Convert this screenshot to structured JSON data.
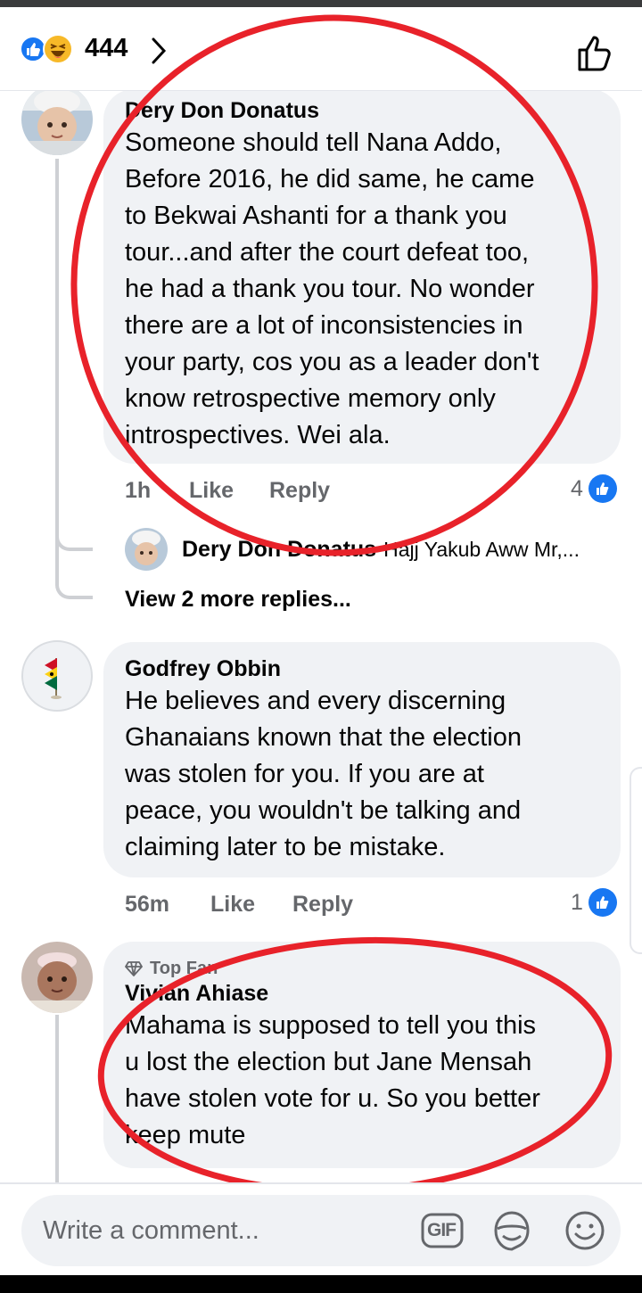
{
  "header": {
    "reaction_count": "444",
    "reaction_icons": [
      "like-icon",
      "haha-icon"
    ],
    "chevron_icon": "chevron-right-icon",
    "like_button_icon": "thumbs-up-outline-icon"
  },
  "comments": [
    {
      "author": "Dery Don Donatus",
      "text": "Someone should tell Nana Addo, Before 2016, he did same, he came to Bekwai Ashanti for a thank you tour...and after the court defeat too, he had a thank you tour. No wonder there are a lot of inconsistencies in your party, cos you as a leader don't know retrospective memory only introspectives. Wei ala.",
      "lines": [
        "Someone should tell Nana Addo,",
        "Before 2016, he did same, he came",
        "to Bekwai Ashanti for a thank you",
        "tour...and after the court defeat too,",
        "he had a thank you tour. No wonder",
        "there are a lot of inconsistencies in",
        "your party, cos you as a leader don't",
        "know retrospective memory only",
        "introspectives. Wei ala."
      ],
      "time": "1h",
      "like_label": "Like",
      "reply_label": "Reply",
      "reactions": "4",
      "reply_preview": {
        "author": "Dery Don Donatus",
        "snippet": "Hajj Yakub Aww Mr,..."
      },
      "more_replies": "View 2 more replies..."
    },
    {
      "author": "Godfrey Obbin",
      "lines": [
        "He believes and every discerning",
        "Ghanaians known that the election",
        "was stolen for you. If you are at",
        "peace, you wouldn't be talking and",
        "claiming later to be mistake."
      ],
      "time": "56m",
      "like_label": "Like",
      "reply_label": "Reply",
      "reactions": "1"
    },
    {
      "badge": "Top Fan",
      "author": "Vivian Ahiase",
      "lines": [
        "Mahama is supposed to tell you this",
        "u lost the election but Jane Mensah",
        "have stolen vote for u. So you better",
        "keep mute"
      ]
    }
  ],
  "composer": {
    "placeholder": "Write a comment...",
    "gif_label": "GIF",
    "sticker_icon": "sticker-icon",
    "emoji_icon": "emoji-icon"
  },
  "colors": {
    "accent": "#1877f2",
    "bubble": "#f0f2f5",
    "annotation": "#e8222a"
  }
}
